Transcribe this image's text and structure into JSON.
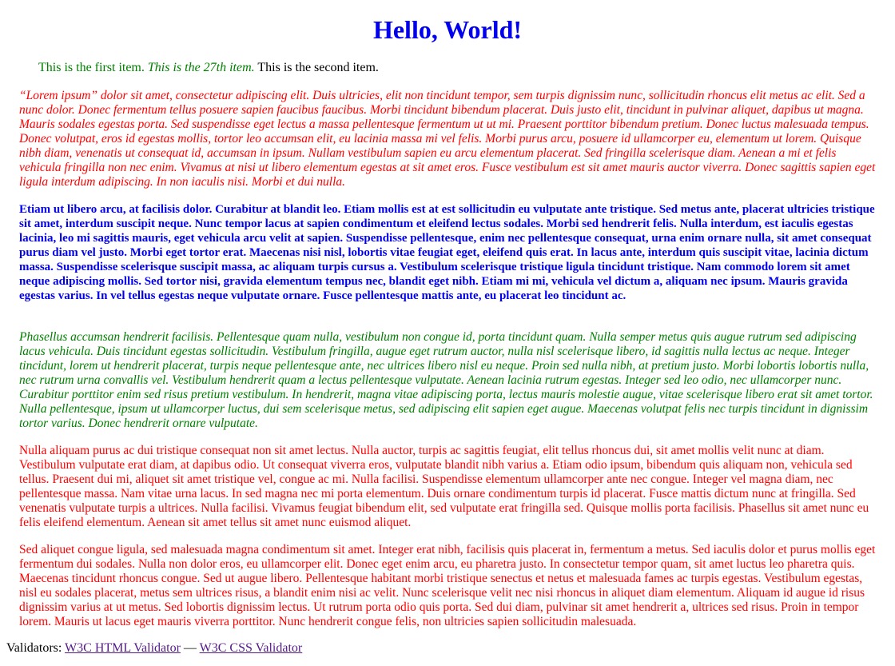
{
  "heading": "Hello, World!",
  "items": {
    "first": "This is the first item.",
    "twenty_seventh": "This is the 27th item.",
    "second": "This is the second item."
  },
  "paragraphs": [
    "“Lorem ipsum” dolor sit amet, consectetur adipiscing elit. Duis ultricies, elit non tincidunt tempor, sem turpis dignissim nunc, sollicitudin rhoncus elit metus ac elit. Sed a nunc dolor. Donec fermentum tellus posuere sapien faucibus faucibus. Morbi tincidunt bibendum placerat. Duis justo elit, tincidunt in pulvinar aliquet, dapibus ut magna. Mauris sodales egestas porta. Sed suspendisse eget lectus a massa pellentesque fermentum ut ut mi. Praesent porttitor bibendum pretium. Donec luctus malesuada tempus. Donec volutpat, eros id egestas mollis, tortor leo accumsan elit, eu lacinia massa mi vel felis. Morbi purus arcu, posuere id ullamcorper eu, elementum ut lorem. Quisque nibh diam, venenatis ut consequat id, accumsan in ipsum. Nullam vestibulum sapien eu arcu elementum placerat. Sed fringilla scelerisque diam. Aenean a mi et felis vehicula fringilla non nec enim. Vivamus at nisi ut libero elementum egestas at sit amet eros. Fusce vestibulum est sit amet mauris auctor viverra. Donec sagittis sapien eget ligula interdum adipiscing. In non iaculis nisi. Morbi et dui nulla.",
    "Etiam ut libero arcu, at facilisis dolor. Curabitur at blandit leo. Etiam mollis est at est sollicitudin eu vulputate ante tristique. Sed metus ante, placerat ultricies tristique sit amet, interdum suscipit neque. Nunc tempor lacus at sapien condimentum et eleifend lectus sodales. Morbi sed hendrerit felis. Nulla interdum, est iaculis egestas lacinia, leo mi sagittis mauris, eget vehicula arcu velit at sapien. Suspendisse pellentesque, enim nec pellentesque consequat, urna enim ornare nulla, sit amet consequat purus diam vel justo. Morbi eget tortor erat. Maecenas nisi nisl, lobortis vitae feugiat eget, eleifend quis erat. In lacus ante, interdum quis suscipit vitae, lacinia dictum massa. Suspendisse scelerisque suscipit massa, ac aliquam turpis cursus a. Vestibulum scelerisque tristique ligula tincidunt tristique. Nam commodo lorem sit amet neque adipiscing mollis. Sed tortor nisi, gravida elementum tempus nec, blandit eget nibh. Etiam mi mi, vehicula vel dictum a, aliquam nec ipsum. Mauris gravida egestas varius. In vel tellus egestas neque vulputate ornare. Fusce pellentesque mattis ante, eu placerat leo tincidunt ac.",
    "Phasellus accumsan hendrerit facilisis. Pellentesque quam nulla, vestibulum non congue id, porta tincidunt quam. Nulla semper metus quis augue rutrum sed adipiscing lacus vehicula. Duis tincidunt egestas sollicitudin. Vestibulum fringilla, augue eget rutrum auctor, nulla nisl scelerisque libero, id sagittis nulla lectus ac neque. Integer tincidunt, lorem ut hendrerit placerat, turpis neque pellentesque ante, nec ultrices libero nisl eu neque. Proin sed nulla nibh, at pretium justo. Morbi lobortis lobortis nulla, nec rutrum urna convallis vel. Vestibulum hendrerit quam a lectus pellentesque vulputate. Aenean lacinia rutrum egestas. Integer sed leo odio, nec ullamcorper nunc. Curabitur porttitor enim sed risus pretium vestibulum. In hendrerit, magna vitae adipiscing porta, lectus mauris molestie augue, vitae scelerisque libero erat sit amet tortor. Nulla pellentesque, ipsum ut ullamcorper luctus, dui sem scelerisque metus, sed adipiscing elit sapien eget augue. Maecenas volutpat felis nec turpis tincidunt in dignissim tortor varius. Donec hendrerit ornare vulputate.",
    "Nulla aliquam purus ac dui tristique consequat non sit amet lectus. Nulla auctor, turpis ac sagittis feugiat, elit tellus rhoncus dui, sit amet mollis velit nunc at diam. Vestibulum vulputate erat diam, at dapibus odio. Ut consequat viverra eros, vulputate blandit nibh varius a. Etiam odio ipsum, bibendum quis aliquam non, vehicula sed tellus. Praesent dui mi, aliquet sit amet tristique vel, congue ac mi. Nulla facilisi. Suspendisse elementum ullamcorper ante nec congue. Integer vel magna diam, nec pellentesque massa. Nam vitae urna lacus. In sed magna nec mi porta elementum. Duis ornare condimentum turpis id placerat. Fusce mattis dictum nunc at fringilla. Sed venenatis vulputate turpis a ultrices. Nulla facilisi. Vivamus feugiat bibendum elit, sed vulputate erat fringilla sed. Quisque mollis porta facilisis. Phasellus sit amet nunc eu felis eleifend elementum. Aenean sit amet tellus sit amet nunc euismod aliquet.",
    "Sed aliquet congue ligula, sed malesuada magna condimentum sit amet. Integer erat nibh, facilisis quis placerat in, fermentum a metus. Sed iaculis dolor et purus mollis eget fermentum dui sodales. Nulla non dolor eros, eu ullamcorper elit. Donec eget enim arcu, eu pharetra justo. In consectetur tempor quam, sit amet luctus leo pharetra quis. Maecenas tincidunt rhoncus congue. Sed ut augue libero. Pellentesque habitant morbi tristique senectus et netus et malesuada fames ac turpis egestas. Vestibulum egestas, nisl eu sodales placerat, metus sem ultrices risus, a blandit enim nisi ac velit. Nunc scelerisque velit nec nisi rhoncus in aliquet diam elementum. Aliquam id augue id risus dignissim varius at ut metus. Sed lobortis dignissim lectus. Ut rutrum porta odio quis porta. Sed dui diam, pulvinar sit amet hendrerit a, ultrices sed risus. Proin in tempor lorem. Mauris ut lacus eget mauris viverra porttitor. Nunc hendrerit congue felis, non ultricies sapien sollicitudin malesuada."
  ],
  "footer": {
    "label": "Validators:",
    "html_link": "W3C HTML Validator",
    "separator": "—",
    "css_link": "W3C CSS Validator"
  },
  "colors": {
    "heading": "#0000ee",
    "green": "#008000",
    "red": "#ff0000",
    "blue": "#0000ee",
    "visited_link": "#551a8b"
  }
}
